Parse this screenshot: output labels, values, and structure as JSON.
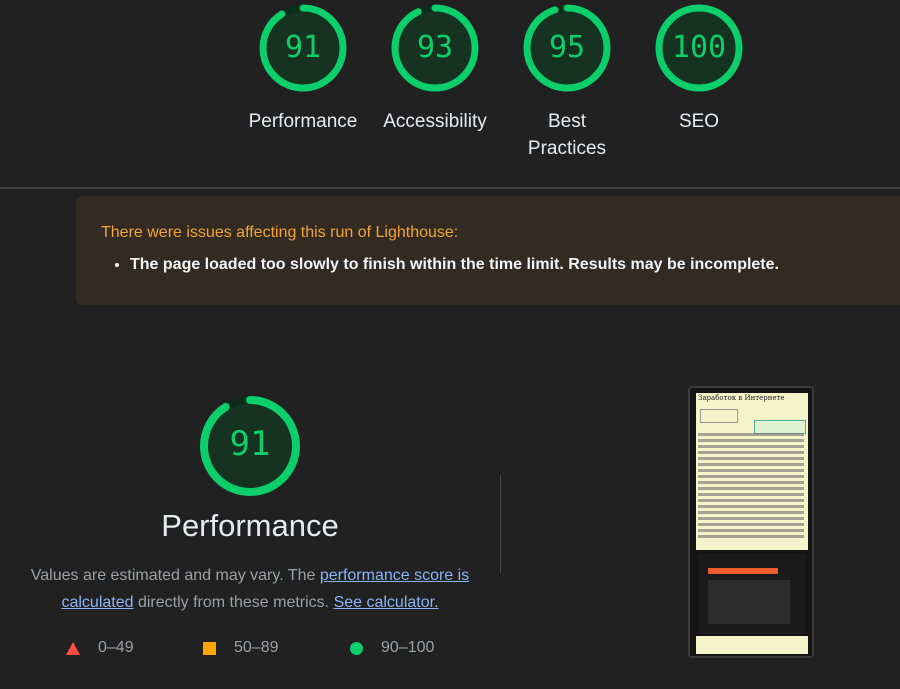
{
  "categories": [
    {
      "score": "91",
      "label": "Performance",
      "value": 91
    },
    {
      "score": "93",
      "label": "Accessibility",
      "value": 93
    },
    {
      "score": "95",
      "label": "Best Practices",
      "value": 95
    },
    {
      "score": "100",
      "label": "SEO",
      "value": 100
    }
  ],
  "warning": {
    "title": "There were issues affecting this run of Lighthouse:",
    "items": [
      "The page loaded too slowly to finish within the time limit. Results may be incomplete."
    ]
  },
  "performance": {
    "score": "91",
    "value": 91,
    "title": "Performance",
    "desc_prefix": "Values are estimated and may vary. The ",
    "link_score": "performance score is calculated",
    "desc_middle": " directly from these metrics. ",
    "link_calc": "See calculator."
  },
  "legend": [
    {
      "shape": "triangle",
      "range": "0–49",
      "color": "#ff4e42"
    },
    {
      "shape": "square",
      "range": "50–89",
      "color": "#ffa400"
    },
    {
      "shape": "circle",
      "range": "90–100",
      "color": "#0cce6b"
    }
  ],
  "screenshot": {
    "title": "Заработок в Интернете",
    "alt": "page screenshot"
  },
  "colors": {
    "pass": "#0cce6b",
    "warning_title": "#f2a33a",
    "link": "#8ab4f8"
  }
}
